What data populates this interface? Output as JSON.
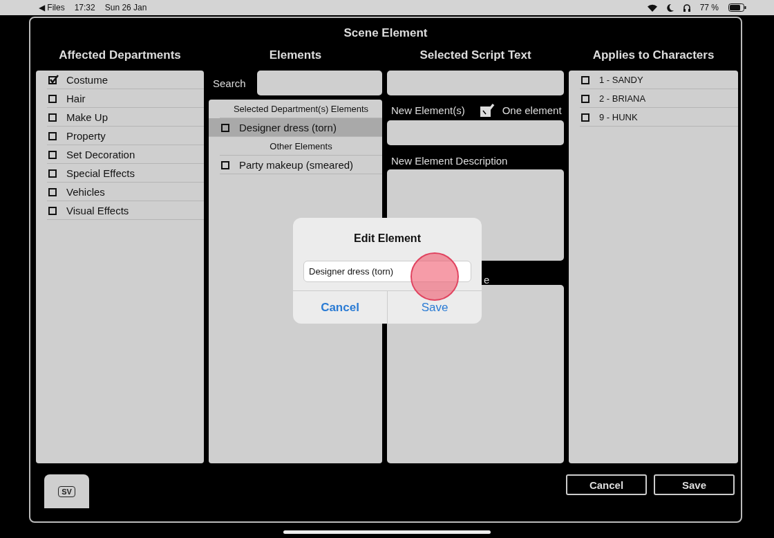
{
  "status_bar": {
    "back": "◀ Files",
    "time": "17:32",
    "date": "Sun 26 Jan",
    "battery": "77 %"
  },
  "window": {
    "title": "Scene Element"
  },
  "departments": {
    "title": "Affected Departments",
    "items": [
      {
        "label": "Costume",
        "checked": true
      },
      {
        "label": "Hair",
        "checked": false
      },
      {
        "label": "Make Up",
        "checked": false
      },
      {
        "label": "Property",
        "checked": false
      },
      {
        "label": "Set Decoration",
        "checked": false
      },
      {
        "label": "Special Effects",
        "checked": false
      },
      {
        "label": "Vehicles",
        "checked": false
      },
      {
        "label": "Visual Effects",
        "checked": false
      }
    ]
  },
  "elements": {
    "title": "Elements",
    "search_label": "Search",
    "sections": [
      {
        "heading": "Selected Department(s) Elements",
        "items": [
          {
            "label": "Designer dress (torn)",
            "checked": false,
            "selected": true
          }
        ]
      },
      {
        "heading": "Other Elements",
        "items": [
          {
            "label": "Party makeup (smeared)",
            "checked": false,
            "selected": false
          }
        ]
      }
    ]
  },
  "script": {
    "title": "Selected Script Text",
    "new_elements_label": "New Element(s)",
    "one_element": {
      "label": "One element",
      "checked": true
    },
    "description_label": "New Element Description",
    "covered_label": "e"
  },
  "characters": {
    "title": "Applies to Characters",
    "items": [
      {
        "label": "1 - SANDY",
        "checked": false
      },
      {
        "label": "2 - BRIANA",
        "checked": false
      },
      {
        "label": "9 - HUNK",
        "checked": false
      }
    ]
  },
  "buttons": {
    "sv": "SV",
    "cancel": "Cancel",
    "save": "Save"
  },
  "dialog": {
    "title": "Edit Element",
    "value": "Designer dress (torn)",
    "buttons": [
      {
        "label": "Cancel",
        "kind": "cancel"
      },
      {
        "label": "Save",
        "kind": "default"
      }
    ]
  }
}
